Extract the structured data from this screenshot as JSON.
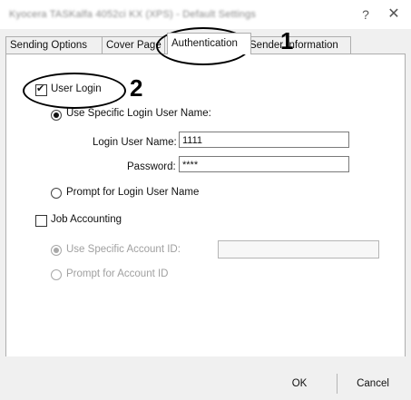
{
  "window": {
    "title": "Kyocera TASKalfa 4052ci KX (XPS) - Default Settings",
    "help_glyph": "?",
    "close_glyph": "✕"
  },
  "tabs": [
    {
      "label": "Sending Options",
      "active": false
    },
    {
      "label": "Cover Page",
      "active": false
    },
    {
      "label": "Authentication",
      "active": true
    },
    {
      "label": "Sender Information",
      "active": false
    }
  ],
  "authentication": {
    "user_login": {
      "label": "User Login",
      "checked": true
    },
    "use_specific_login": {
      "label": "Use Specific Login User Name:",
      "selected": true
    },
    "login_user_name": {
      "label": "Login User Name:",
      "value": "1111"
    },
    "password": {
      "label": "Password:",
      "value": "****"
    },
    "prompt_login": {
      "label": "Prompt for Login User Name",
      "selected": false
    }
  },
  "job_accounting": {
    "checkbox": {
      "label": "Job Accounting",
      "checked": false
    },
    "use_specific_account": {
      "label": "Use Specific Account ID:",
      "selected": true,
      "enabled": false,
      "value": ""
    },
    "prompt_account": {
      "label": "Prompt for Account ID",
      "selected": false,
      "enabled": false
    }
  },
  "buttons": {
    "ok": "OK",
    "cancel": "Cancel"
  },
  "callouts": {
    "one": "1",
    "two": "2"
  }
}
